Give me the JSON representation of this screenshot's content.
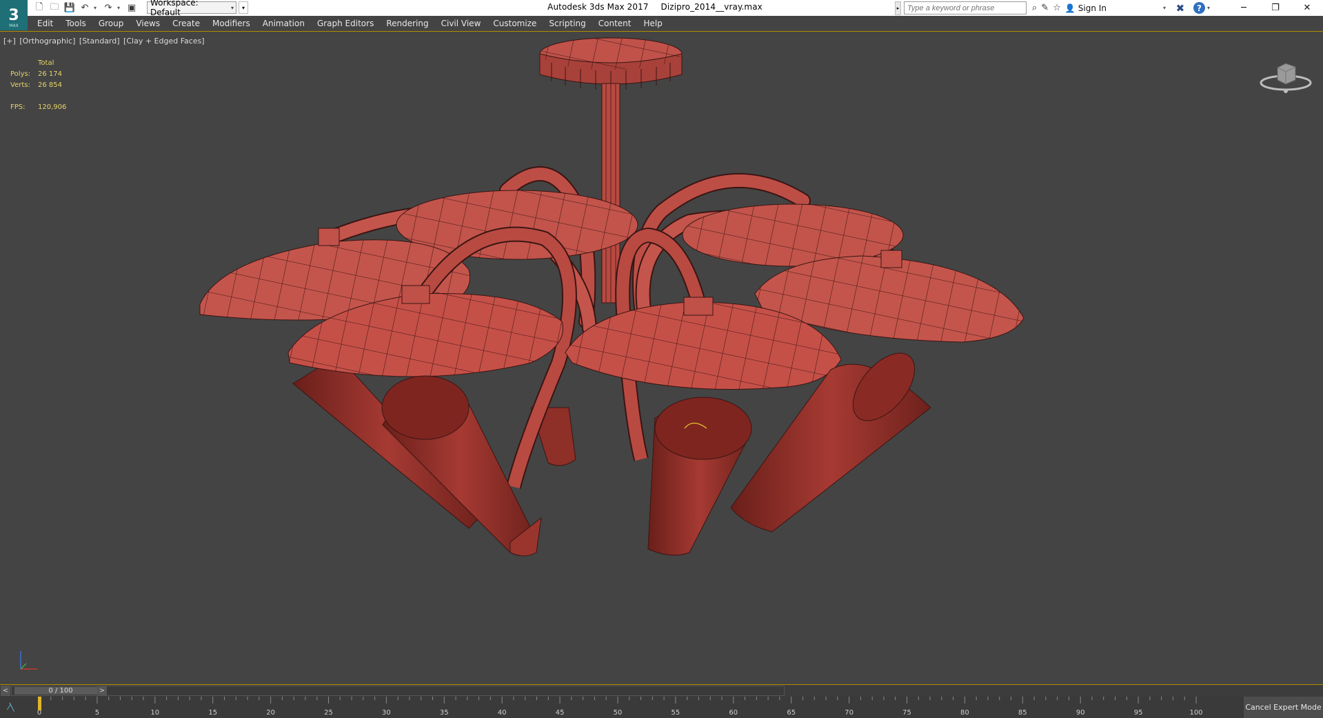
{
  "titlebar": {
    "logo": "3",
    "logo_sub": "MAX",
    "workspace_label": "Workspace: Default",
    "app_name": "Autodesk 3ds Max 2017",
    "file_name": "Dizipro_2014__vray.max",
    "search_placeholder": "Type a keyword or phrase",
    "sign_in": "Sign In",
    "help": "?"
  },
  "menu": [
    "Edit",
    "Tools",
    "Group",
    "Views",
    "Create",
    "Modifiers",
    "Animation",
    "Graph Editors",
    "Rendering",
    "Civil View",
    "Customize",
    "Scripting",
    "Content",
    "Help"
  ],
  "viewport": {
    "labels": [
      "[+]",
      "[Orthographic]",
      "[Standard]",
      "[Clay + Edged Faces]"
    ],
    "stats": {
      "header": "Total",
      "polys_label": "Polys:",
      "polys": "26 174",
      "verts_label": "Verts:",
      "verts": "26 854",
      "fps_label": "FPS:",
      "fps": "120,906"
    },
    "model_color": "#c55048",
    "border_color": "#b38d00"
  },
  "timeline": {
    "frame_display": "0 / 100",
    "prev": "<",
    "next": ">",
    "ticks": [
      "0",
      "5",
      "10",
      "15",
      "20",
      "25",
      "30",
      "35",
      "40",
      "45",
      "50",
      "55",
      "60",
      "65",
      "70",
      "75",
      "80",
      "85",
      "90",
      "95",
      "100"
    ],
    "cancel_expert": "Cancel Expert Mode"
  }
}
